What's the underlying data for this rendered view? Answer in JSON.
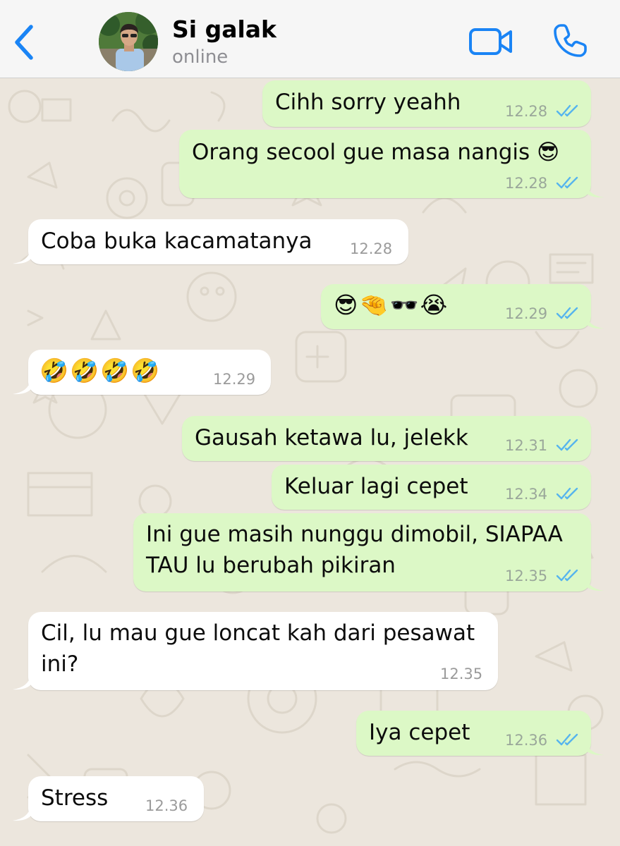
{
  "header": {
    "contact_name": "Si galak",
    "status": "online"
  },
  "messages": [
    {
      "direction": "out",
      "text": "Cihh sorry yeahh",
      "time": "12.28",
      "read": true
    },
    {
      "direction": "out",
      "text": "Orang secool gue masa nangis 😎",
      "time": "12.28",
      "read": true
    },
    {
      "direction": "in",
      "text": "Coba buka kacamatanya",
      "time": "12.28"
    },
    {
      "direction": "out",
      "text": "😎🤏🕶️😭",
      "time": "12.29",
      "read": true
    },
    {
      "direction": "in",
      "text": "🤣🤣🤣🤣",
      "time": "12.29"
    },
    {
      "direction": "out",
      "text": "Gausah ketawa lu, jelekk",
      "time": "12.31",
      "read": true
    },
    {
      "direction": "out",
      "text": "Keluar lagi cepet",
      "time": "12.34",
      "read": true
    },
    {
      "direction": "out",
      "text": "Ini gue masih nunggu dimobil, SIAPAA\nTAU lu berubah pikiran",
      "time": "12.35",
      "read": true
    },
    {
      "direction": "in",
      "text": "Cil, lu mau gue loncat kah dari pesawat\nini?",
      "time": "12.35"
    },
    {
      "direction": "out",
      "text": "Iya cepet",
      "time": "12.36",
      "read": true
    },
    {
      "direction": "in",
      "text": "Stress",
      "time": "12.36"
    }
  ],
  "colors": {
    "accent": "#1a84f5",
    "outgoing_bubble": "#dcf8c6",
    "incoming_bubble": "#ffffff",
    "read_ticks": "#56b4ee",
    "chat_background": "#ece6dd"
  },
  "icons": {
    "back": "chevron-left-icon",
    "video_call": "video-camera-icon",
    "voice_call": "phone-icon",
    "read_receipt": "double-check-icon"
  }
}
